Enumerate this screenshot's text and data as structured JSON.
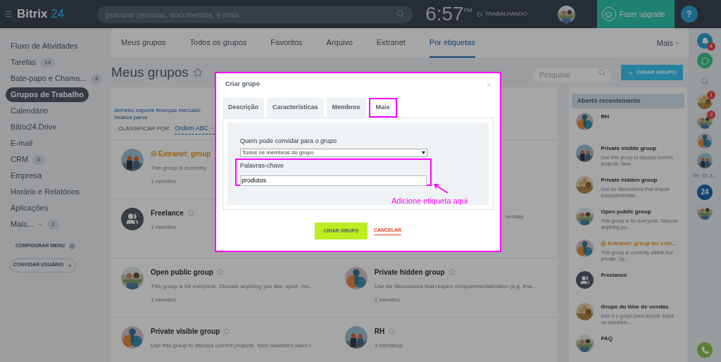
{
  "header": {
    "logo": "Bitrix",
    "logo_suffix": "24",
    "search": {
      "placeholder": "procurar pessoas, documentos, e mais"
    },
    "clock": "6:57",
    "clock_suffix": "PM",
    "status": "TRABALHANDO",
    "upgrade": "Fazer upgrade",
    "help": "?"
  },
  "sidebar": {
    "items": [
      {
        "label": "Fluxo de Atividades",
        "selected": false
      },
      {
        "label": "Tarefas",
        "count": "14",
        "selected": false
      },
      {
        "label": "Bate-papo e Chama...",
        "count": "4",
        "selected": false
      },
      {
        "label": "Grupos de Trabalho",
        "selected": true
      },
      {
        "label": "Calendário",
        "selected": false
      },
      {
        "label": "Bitrix24.Drive",
        "selected": false
      },
      {
        "label": "E-mail",
        "selected": false
      },
      {
        "label": "CRM",
        "count": "3",
        "selected": false
      },
      {
        "label": "Empresa",
        "selected": false
      },
      {
        "label": "Horário e Relatórios",
        "selected": false
      },
      {
        "label": "Aplicações",
        "selected": false
      },
      {
        "label": "Mais...",
        "count": "2",
        "selected": false,
        "dropdown": true
      }
    ],
    "configure": "CONFIGURAR MENU",
    "invite": "CONVIDAR USUÁRIO"
  },
  "tabs": [
    {
      "label": "Meus grupos",
      "selected": false
    },
    {
      "label": "Todos os grupos",
      "selected": false
    },
    {
      "label": "Favoritos",
      "selected": false
    },
    {
      "label": "Arquivo",
      "selected": false
    },
    {
      "label": "Extranet",
      "selected": false
    },
    {
      "label": "Por etiquetas",
      "selected": true
    }
  ],
  "tabs_more": "Mais",
  "page": {
    "title": "Meus grupos",
    "search": {
      "placeholder": "Pesquisar"
    },
    "create_button": "CRIAR GRUPO"
  },
  "filter": {
    "tags": "dinheiro esporte finanças mercado música parce",
    "sort_label": "CLASSIFICAR POR:",
    "sort_value": "Ordem ABC"
  },
  "group_rows": [
    {
      "left": {
        "title": "Extranet: group",
        "extranet": true,
        "description": "This group is currently",
        "members": "1 membro",
        "kind": "picture"
      }
    },
    {
      "left": {
        "title": "Freelance",
        "extranet": false,
        "members": "1 membro",
        "kind": "group-icon"
      },
      "right": {
        "description": "vendas"
      }
    },
    {
      "left": {
        "title": "Open public group",
        "extranet": false,
        "description": "This group is for everyone. Discuss anything you like: sport, mu...",
        "members": "1 membro",
        "kind": "picture"
      },
      "right": {
        "title": "Private hidden group",
        "extranet": false,
        "description": "Use for discussions that require compartmentalization (e.g. fina...",
        "members": "1 membro",
        "kind": "picture"
      }
    },
    {
      "left": {
        "title": "Private visible group",
        "extranet": false,
        "description": "Use this group to discuss current projects. New members need t...",
        "kind": "picture"
      },
      "right": {
        "title": "RH",
        "extranet": false,
        "members": "3 membros",
        "kind": "picture"
      }
    }
  ],
  "recent": {
    "title": "Aberto recentemente",
    "items": [
      {
        "title": "RH",
        "extranet": false,
        "kind": "picture"
      },
      {
        "title": "Private visible group",
        "extranet": false,
        "description": "Use this group to discuss current projects. New...",
        "kind": "picture"
      },
      {
        "title": "Private hidden group",
        "extranet": false,
        "description": "Use for discussions that require compartmentali...",
        "kind": "picture"
      },
      {
        "title": "Open public group",
        "extranet": false,
        "description": "This group is for everyone. Discuss anything yo...",
        "kind": "picture"
      },
      {
        "title": "Extranet: group for exte...",
        "extranet": true,
        "description": "This group is currently visible but private. Up...",
        "kind": "picture"
      },
      {
        "title": "Freelance",
        "extranet": false,
        "kind": "group-icon"
      },
      {
        "title": "Grupo do time de vendas",
        "extranet": false,
        "description": "este é o grupo para discutir todos os assuntos ...",
        "kind": "picture"
      },
      {
        "title": "FAQ",
        "extranet": false,
        "kind": "picture"
      }
    ]
  },
  "right_bar": {
    "notifications": "4",
    "chats": [
      {
        "badge": "1",
        "kind": "picture"
      },
      {
        "badge": "3",
        "kind": "picture"
      },
      {
        "kind": "picture"
      },
      {
        "kind": "picture"
      }
    ],
    "date": "Ter. 15. A...",
    "logo": "24"
  },
  "dialog": {
    "title": "Criar grupo",
    "close": "×",
    "tabs": [
      {
        "label": "Descrição",
        "selected": false
      },
      {
        "label": "Características",
        "selected": false
      },
      {
        "label": "Membros",
        "selected": false
      },
      {
        "label": "Mais",
        "selected": true
      }
    ],
    "invite_label": "Quem pode convidar para o grupo",
    "invite_value": "Todos os membros do grupo",
    "keywords_label": "Palavras-chave",
    "keywords_value": "produtos",
    "submit": "CRIAR GRUPO",
    "cancel": "CANCELAR"
  },
  "annotation": {
    "text": "Adicione etiqueta aqui"
  }
}
